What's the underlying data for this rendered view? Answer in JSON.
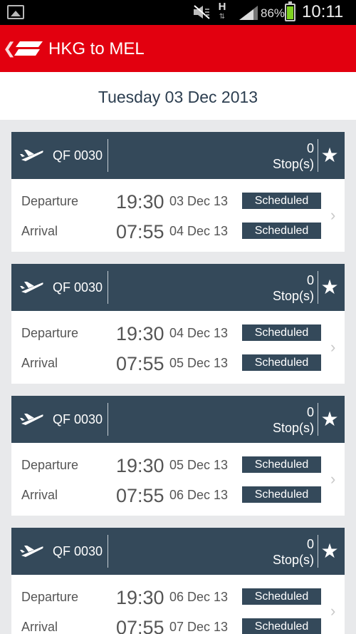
{
  "status_bar": {
    "battery_percent": "86%",
    "time": "10:11",
    "network_letter": "H",
    "icons": [
      "image-icon",
      "mute-icon",
      "signal-icon",
      "battery-icon"
    ]
  },
  "header": {
    "title": "HKG to MEL",
    "accent_color": "#e2000f",
    "back_glyph": "❮"
  },
  "date_bar": {
    "date": "Tuesday 03 Dec 2013"
  },
  "labels": {
    "departure": "Departure",
    "arrival": "Arrival"
  },
  "flights": [
    {
      "flight_no": "QF 0030",
      "stops_count": "0",
      "stops_label": "Stop(s)",
      "departure": {
        "time": "19:30",
        "date": "03 Dec 13",
        "status": "Scheduled"
      },
      "arrival": {
        "time": "07:55",
        "date": "04 Dec 13",
        "status": "Scheduled"
      }
    },
    {
      "flight_no": "QF 0030",
      "stops_count": "0",
      "stops_label": "Stop(s)",
      "departure": {
        "time": "19:30",
        "date": "04 Dec 13",
        "status": "Scheduled"
      },
      "arrival": {
        "time": "07:55",
        "date": "05 Dec 13",
        "status": "Scheduled"
      }
    },
    {
      "flight_no": "QF 0030",
      "stops_count": "0",
      "stops_label": "Stop(s)",
      "departure": {
        "time": "19:30",
        "date": "05 Dec 13",
        "status": "Scheduled"
      },
      "arrival": {
        "time": "07:55",
        "date": "06 Dec 13",
        "status": "Scheduled"
      }
    },
    {
      "flight_no": "QF 0030",
      "stops_count": "0",
      "stops_label": "Stop(s)",
      "departure": {
        "time": "19:30",
        "date": "06 Dec 13",
        "status": "Scheduled"
      },
      "arrival": {
        "time": "07:55",
        "date": "07 Dec 13",
        "status": "Scheduled"
      }
    }
  ],
  "colors": {
    "card_header": "#34495a",
    "status_badge": "#34495a",
    "background": "#e8e9eb"
  }
}
